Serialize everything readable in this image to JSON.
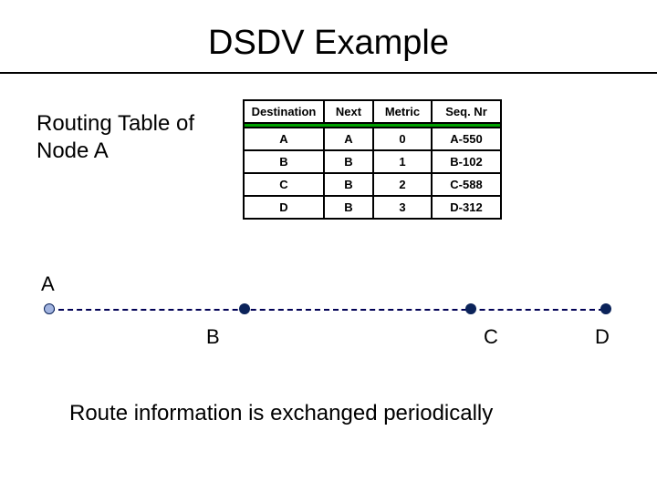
{
  "title": "DSDV Example",
  "caption_line1": "Routing Table of",
  "caption_line2": "Node A",
  "table": {
    "headers": [
      "Destination",
      "Next",
      "Metric",
      "Seq. Nr"
    ],
    "rows": [
      {
        "dest": "A",
        "next": "A",
        "metric": "0",
        "seq": "A-550"
      },
      {
        "dest": "B",
        "next": "B",
        "metric": "1",
        "seq": "B-102"
      },
      {
        "dest": "C",
        "next": "B",
        "metric": "2",
        "seq": "C-588"
      },
      {
        "dest": "D",
        "next": "B",
        "metric": "3",
        "seq": "D-312"
      }
    ]
  },
  "nodes": [
    "A",
    "B",
    "C",
    "D"
  ],
  "footer": "Route information is exchanged periodically",
  "colors": {
    "accent": "#00a000",
    "node": "#0b235a"
  },
  "chart_data": {
    "type": "table",
    "title": "Routing Table of Node A",
    "columns": [
      "Destination",
      "Next",
      "Metric",
      "Seq. Nr"
    ],
    "rows": [
      [
        "A",
        "A",
        0,
        "A-550"
      ],
      [
        "B",
        "B",
        1,
        "B-102"
      ],
      [
        "C",
        "B",
        2,
        "C-588"
      ],
      [
        "D",
        "B",
        3,
        "D-312"
      ]
    ]
  }
}
